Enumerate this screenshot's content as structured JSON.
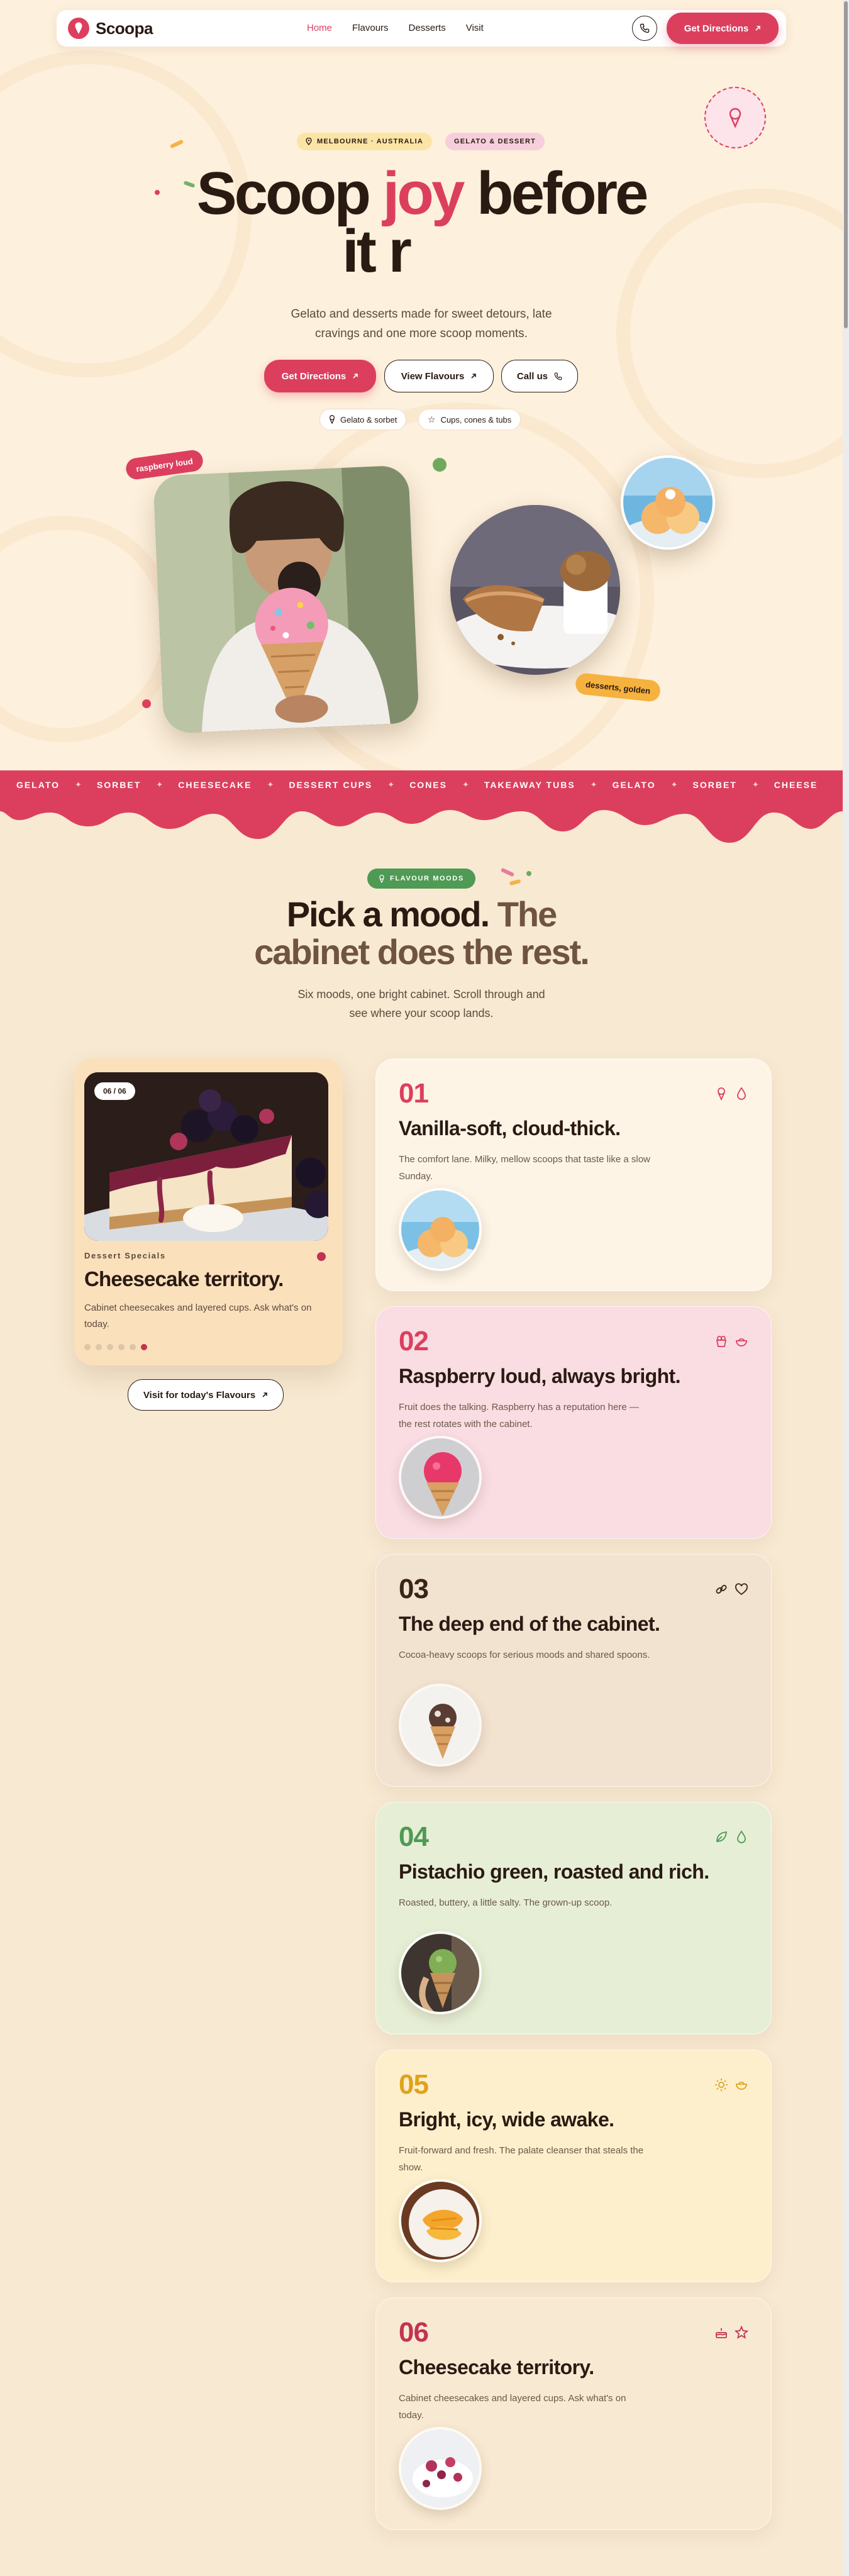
{
  "brand": {
    "name": "Scoopa",
    "accent": "#dc3f5e",
    "ink": "#2a1a12",
    "cream": "#fdf0dc"
  },
  "nav": {
    "links": [
      {
        "label": "Home",
        "active": true
      },
      {
        "label": "Flavours",
        "active": false
      },
      {
        "label": "Desserts",
        "active": false
      },
      {
        "label": "Visit",
        "active": false
      }
    ],
    "phone_icon": "phone-icon",
    "cta_label": "Get Directions"
  },
  "hero": {
    "location_tag": "MELBOURNE · AUSTRALIA",
    "category_tag": "GELATO & DESSERT",
    "title_start": "Scoop ",
    "title_accent": "joy",
    "title_end": " before",
    "title_line2": "it r",
    "subtitle": "Gelato and desserts made for sweet detours, late cravings and one more scoop moments.",
    "buttons": {
      "directions": "Get Directions",
      "flavours": "View Flavours",
      "call": "Call us"
    },
    "chips": [
      {
        "label": "Gelato & sorbet",
        "icon": "cone-icon"
      },
      {
        "label": "Cups, cones & tubs",
        "icon": "star-icon"
      }
    ],
    "stickers": {
      "raspberry": "raspberry loud",
      "golden": "desserts, golden"
    }
  },
  "band": {
    "items": [
      "GELATO",
      "SORBET",
      "CHEESECAKE",
      "DESSERT CUPS",
      "CONES",
      "TAKEAWAY TUBS",
      "GELATO",
      "SORBET",
      "CHEESE"
    ]
  },
  "moods": {
    "tag": "FLAVOUR MOODS",
    "title_main": "Pick a mood.",
    "title_muted_1": " The",
    "title_muted_2": "cabinet does the rest.",
    "subtitle": "Six moods, one bright cabinet. Scroll through and see where your scoop lands.",
    "preview": {
      "count": "06 / 06",
      "eyebrow": "Dessert Specials",
      "title": "Cheesecake territory.",
      "description": "Cabinet cheesecakes and layered cups. Ask what's on today.",
      "active_index": 6
    },
    "visit_button": "Visit for today's Flavours",
    "cards": [
      {
        "num": "01",
        "title": "Vanilla-soft, cloud-thick.",
        "description": "The comfort lane. Milky, mellow scoops that taste like a slow Sunday.",
        "num_color": "#dc3f5e",
        "bg": "#fdf4e6",
        "icons": [
          "cone-icon",
          "drop-icon"
        ]
      },
      {
        "num": "02",
        "title": "Raspberry loud, always bright.",
        "description": "Fruit does the talking. Raspberry has a reputation here — the rest rotates with the cabinet.",
        "num_color": "#dc3f5e",
        "bg": "#f9dde3",
        "icons": [
          "cup-icon",
          "bowl-icon"
        ]
      },
      {
        "num": "03",
        "title": "The deep end of the cabinet.",
        "description": "Cocoa-heavy scoops for serious moods and shared spoons.",
        "num_color": "#3a2418",
        "bg": "#f2e2d0",
        "icons": [
          "link-icon",
          "heart-icon"
        ]
      },
      {
        "num": "04",
        "title": "Pistachio green, roasted and rich.",
        "description": "Roasted, buttery, a little salty. The grown-up scoop.",
        "num_color": "#4f9a54",
        "bg": "#e6efd6",
        "icons": [
          "leaf-icon",
          "drop-icon"
        ]
      },
      {
        "num": "05",
        "title": "Bright, icy, wide awake.",
        "description": "Fruit-forward and fresh. The palate cleanser that steals the show.",
        "num_color": "#e0a21c",
        "bg": "#fdefcc",
        "icons": [
          "sun-icon",
          "bowl-icon"
        ]
      },
      {
        "num": "06",
        "title": "Cheesecake territory.",
        "description": "Cabinet cheesecakes and layered cups. Ask what's on today.",
        "num_color": "#c23352",
        "bg": "#f8e9d2",
        "icons": [
          "cake-icon",
          "star-icon"
        ]
      }
    ]
  }
}
